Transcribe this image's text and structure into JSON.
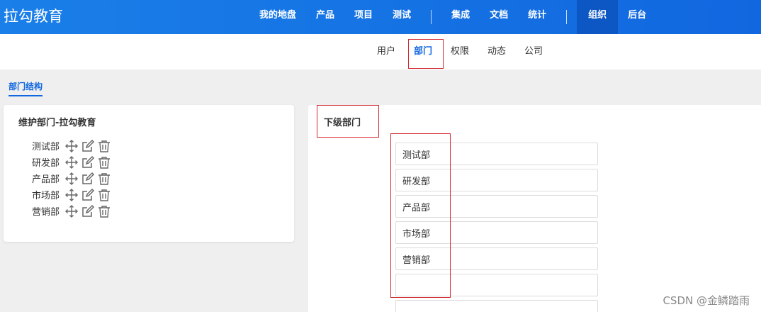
{
  "brand": "拉勾教育",
  "mainnav": {
    "group1": [
      "我的地盘",
      "产品",
      "项目",
      "测试"
    ],
    "group2": [
      "集成",
      "文档",
      "统计"
    ],
    "group3": [
      "组织",
      "后台"
    ]
  },
  "subnav": [
    "用户",
    "部门",
    "权限",
    "动态",
    "公司"
  ],
  "page_tab": "部门结构",
  "left_panel": {
    "title": "维护部门-拉勾教育",
    "departments": [
      "测试部",
      "研发部",
      "产品部",
      "市场部",
      "营销部"
    ],
    "row_icons": [
      "move-icon",
      "edit-icon",
      "delete-icon"
    ]
  },
  "right_panel": {
    "title": "下级部门",
    "inputs": [
      "测试部",
      "研发部",
      "产品部",
      "市场部",
      "营销部",
      "",
      ""
    ]
  },
  "watermark": "CSDN @金鳞踏雨",
  "colors": {
    "accent": "#1167df",
    "highlight_box": "#d3282f"
  }
}
